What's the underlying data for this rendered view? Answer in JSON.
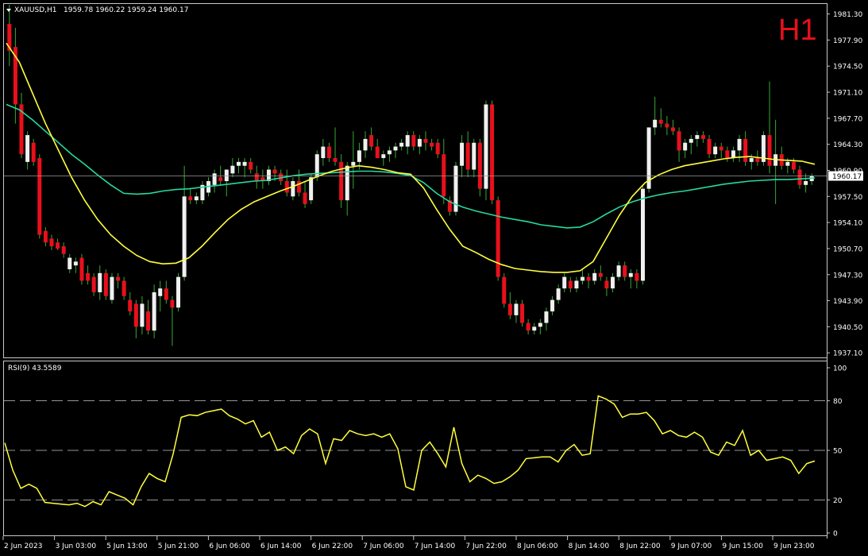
{
  "header": {
    "symbol": "XAUUSD,H1",
    "ohlc": "1959.78 1960.22 1959.24 1960.17",
    "timeframe": "H1"
  },
  "price_axis": {
    "ticks": [
      "1981.30",
      "1977.90",
      "1974.50",
      "1971.10",
      "1967.70",
      "1964.30",
      "1960.90",
      "1957.50",
      "1954.10",
      "1950.70",
      "1947.30",
      "1943.90",
      "1940.50",
      "1937.10"
    ],
    "current_price": "1960.17"
  },
  "rsi_panel": {
    "label": "RSI(9) 43.5589",
    "ticks": [
      "100",
      "80",
      "50",
      "20",
      "0"
    ],
    "levels": [
      80,
      50,
      20
    ]
  },
  "time_axis": {
    "labels": [
      "2 Jun 2023",
      "3 Jun 03:00",
      "5 Jun 13:00",
      "5 Jun 21:00",
      "6 Jun 06:00",
      "6 Jun 14:00",
      "6 Jun 22:00",
      "7 Jun 06:00",
      "7 Jun 14:00",
      "7 Jun 22:00",
      "8 Jun 06:00",
      "8 Jun 14:00",
      "8 Jun 22:00",
      "9 Jun 07:00",
      "9 Jun 15:00",
      "9 Jun 23:00"
    ]
  },
  "colors": {
    "background": "#000000",
    "bull": "#f0f0f0",
    "bear": "#e8101c",
    "wick": "#37a837",
    "ma_fast": "#ffff3c",
    "ma_slow": "#25d9a0",
    "rsi": "#ffff3c",
    "grid_text": "#ffffff",
    "timeframe": "#e8101c"
  },
  "chart_data": {
    "type": "candlestick",
    "title": "XAUUSD,H1",
    "ylim": [
      1936.5,
      1982.5
    ],
    "candles": [
      {
        "o": 1980.0,
        "h": 1982.5,
        "l": 1974.5,
        "c": 1976.5
      },
      {
        "o": 1977.0,
        "h": 1979.5,
        "l": 1967.0,
        "c": 1969.5
      },
      {
        "o": 1969.5,
        "h": 1971.0,
        "l": 1962.5,
        "c": 1963.0
      },
      {
        "o": 1962.0,
        "h": 1966.0,
        "l": 1961.0,
        "c": 1965.5
      },
      {
        "o": 1964.5,
        "h": 1965.0,
        "l": 1961.5,
        "c": 1962.0
      },
      {
        "o": 1962.5,
        "h": 1963.0,
        "l": 1952.0,
        "c": 1952.5
      },
      {
        "o": 1953.0,
        "h": 1953.5,
        "l": 1951.0,
        "c": 1951.5
      },
      {
        "o": 1952.0,
        "h": 1952.5,
        "l": 1950.5,
        "c": 1951.0
      },
      {
        "o": 1951.5,
        "h": 1952.0,
        "l": 1950.5,
        "c": 1950.7
      },
      {
        "o": 1951.0,
        "h": 1951.5,
        "l": 1949.5,
        "c": 1950.0
      },
      {
        "o": 1948.0,
        "h": 1950.0,
        "l": 1947.5,
        "c": 1949.5
      },
      {
        "o": 1948.5,
        "h": 1949.5,
        "l": 1947.5,
        "c": 1949.0
      },
      {
        "o": 1949.5,
        "h": 1950.0,
        "l": 1946.0,
        "c": 1946.5
      },
      {
        "o": 1947.5,
        "h": 1948.5,
        "l": 1946.0,
        "c": 1946.5
      },
      {
        "o": 1947.0,
        "h": 1947.5,
        "l": 1944.5,
        "c": 1945.0
      },
      {
        "o": 1945.0,
        "h": 1948.5,
        "l": 1944.0,
        "c": 1947.5
      },
      {
        "o": 1947.5,
        "h": 1948.0,
        "l": 1944.0,
        "c": 1944.5
      },
      {
        "o": 1944.0,
        "h": 1947.5,
        "l": 1943.5,
        "c": 1947.0
      },
      {
        "o": 1947.0,
        "h": 1947.5,
        "l": 1945.5,
        "c": 1946.5
      },
      {
        "o": 1946.5,
        "h": 1947.0,
        "l": 1944.0,
        "c": 1944.5
      },
      {
        "o": 1944.0,
        "h": 1945.0,
        "l": 1942.0,
        "c": 1942.5
      },
      {
        "o": 1943.5,
        "h": 1944.0,
        "l": 1939.0,
        "c": 1940.5
      },
      {
        "o": 1940.5,
        "h": 1944.5,
        "l": 1939.5,
        "c": 1943.5
      },
      {
        "o": 1942.5,
        "h": 1944.0,
        "l": 1939.5,
        "c": 1940.0
      },
      {
        "o": 1940.0,
        "h": 1946.0,
        "l": 1939.0,
        "c": 1945.0
      },
      {
        "o": 1944.5,
        "h": 1946.5,
        "l": 1942.5,
        "c": 1945.5
      },
      {
        "o": 1945.5,
        "h": 1946.5,
        "l": 1943.5,
        "c": 1944.0
      },
      {
        "o": 1944.0,
        "h": 1944.5,
        "l": 1938.0,
        "c": 1943.0
      },
      {
        "o": 1943.0,
        "h": 1947.5,
        "l": 1942.5,
        "c": 1947.0
      },
      {
        "o": 1947.0,
        "h": 1961.5,
        "l": 1946.5,
        "c": 1957.5
      },
      {
        "o": 1957.5,
        "h": 1958.5,
        "l": 1956.5,
        "c": 1957.0
      },
      {
        "o": 1957.0,
        "h": 1958.0,
        "l": 1956.5,
        "c": 1957.5
      },
      {
        "o": 1957.0,
        "h": 1959.5,
        "l": 1956.5,
        "c": 1959.0
      },
      {
        "o": 1958.0,
        "h": 1960.0,
        "l": 1957.5,
        "c": 1959.5
      },
      {
        "o": 1959.0,
        "h": 1961.0,
        "l": 1958.0,
        "c": 1960.5
      },
      {
        "o": 1960.0,
        "h": 1961.5,
        "l": 1959.0,
        "c": 1959.5
      },
      {
        "o": 1959.5,
        "h": 1961.0,
        "l": 1957.5,
        "c": 1961.0
      },
      {
        "o": 1960.5,
        "h": 1962.5,
        "l": 1960.0,
        "c": 1961.5
      },
      {
        "o": 1961.5,
        "h": 1962.5,
        "l": 1960.5,
        "c": 1962.0
      },
      {
        "o": 1961.5,
        "h": 1962.5,
        "l": 1960.0,
        "c": 1962.0
      },
      {
        "o": 1962.0,
        "h": 1962.5,
        "l": 1960.5,
        "c": 1961.0
      },
      {
        "o": 1960.5,
        "h": 1961.5,
        "l": 1958.5,
        "c": 1959.5
      },
      {
        "o": 1960.0,
        "h": 1961.0,
        "l": 1958.5,
        "c": 1959.5
      },
      {
        "o": 1959.5,
        "h": 1961.5,
        "l": 1959.0,
        "c": 1961.0
      },
      {
        "o": 1961.0,
        "h": 1961.5,
        "l": 1959.5,
        "c": 1960.5
      },
      {
        "o": 1960.5,
        "h": 1961.0,
        "l": 1959.0,
        "c": 1959.5
      },
      {
        "o": 1959.5,
        "h": 1961.0,
        "l": 1957.5,
        "c": 1958.0
      },
      {
        "o": 1957.5,
        "h": 1960.0,
        "l": 1957.0,
        "c": 1959.5
      },
      {
        "o": 1959.5,
        "h": 1961.0,
        "l": 1957.5,
        "c": 1958.0
      },
      {
        "o": 1958.0,
        "h": 1959.5,
        "l": 1956.0,
        "c": 1956.5
      },
      {
        "o": 1957.0,
        "h": 1960.5,
        "l": 1956.5,
        "c": 1960.0
      },
      {
        "o": 1960.0,
        "h": 1963.5,
        "l": 1959.5,
        "c": 1963.0
      },
      {
        "o": 1962.5,
        "h": 1965.0,
        "l": 1961.5,
        "c": 1964.0
      },
      {
        "o": 1964.0,
        "h": 1964.5,
        "l": 1962.0,
        "c": 1962.5
      },
      {
        "o": 1962.5,
        "h": 1966.5,
        "l": 1961.5,
        "c": 1962.0
      },
      {
        "o": 1962.0,
        "h": 1963.0,
        "l": 1956.0,
        "c": 1957.0
      },
      {
        "o": 1957.0,
        "h": 1962.0,
        "l": 1955.0,
        "c": 1961.5
      },
      {
        "o": 1961.5,
        "h": 1966.0,
        "l": 1958.5,
        "c": 1962.0
      },
      {
        "o": 1962.0,
        "h": 1964.5,
        "l": 1961.0,
        "c": 1963.5
      },
      {
        "o": 1963.5,
        "h": 1966.0,
        "l": 1962.5,
        "c": 1965.0
      },
      {
        "o": 1965.5,
        "h": 1966.5,
        "l": 1963.5,
        "c": 1964.0
      },
      {
        "o": 1964.0,
        "h": 1965.0,
        "l": 1962.5,
        "c": 1962.5
      },
      {
        "o": 1962.5,
        "h": 1963.5,
        "l": 1961.5,
        "c": 1963.0
      },
      {
        "o": 1963.0,
        "h": 1964.0,
        "l": 1962.0,
        "c": 1963.5
      },
      {
        "o": 1963.5,
        "h": 1964.5,
        "l": 1962.5,
        "c": 1964.0
      },
      {
        "o": 1964.0,
        "h": 1965.0,
        "l": 1963.5,
        "c": 1964.5
      },
      {
        "o": 1964.0,
        "h": 1966.0,
        "l": 1963.0,
        "c": 1965.5
      },
      {
        "o": 1965.5,
        "h": 1966.0,
        "l": 1963.5,
        "c": 1964.0
      },
      {
        "o": 1964.0,
        "h": 1965.5,
        "l": 1963.0,
        "c": 1965.0
      },
      {
        "o": 1965.0,
        "h": 1966.0,
        "l": 1963.5,
        "c": 1964.5
      },
      {
        "o": 1964.5,
        "h": 1965.0,
        "l": 1963.5,
        "c": 1964.0
      },
      {
        "o": 1964.5,
        "h": 1965.0,
        "l": 1962.5,
        "c": 1963.0
      },
      {
        "o": 1963.0,
        "h": 1965.0,
        "l": 1956.5,
        "c": 1957.5
      },
      {
        "o": 1957.0,
        "h": 1957.5,
        "l": 1955.0,
        "c": 1955.5
      },
      {
        "o": 1955.5,
        "h": 1962.0,
        "l": 1955.0,
        "c": 1961.5
      },
      {
        "o": 1961.5,
        "h": 1965.5,
        "l": 1960.0,
        "c": 1964.5
      },
      {
        "o": 1964.5,
        "h": 1966.0,
        "l": 1960.0,
        "c": 1961.0
      },
      {
        "o": 1961.0,
        "h": 1965.0,
        "l": 1960.0,
        "c": 1964.5
      },
      {
        "o": 1964.5,
        "h": 1965.0,
        "l": 1957.5,
        "c": 1958.5
      },
      {
        "o": 1958.5,
        "h": 1970.0,
        "l": 1957.0,
        "c": 1969.5
      },
      {
        "o": 1969.5,
        "h": 1970.0,
        "l": 1956.5,
        "c": 1957.0
      },
      {
        "o": 1957.0,
        "h": 1957.5,
        "l": 1946.5,
        "c": 1947.0
      },
      {
        "o": 1947.0,
        "h": 1947.5,
        "l": 1943.0,
        "c": 1943.5
      },
      {
        "o": 1943.5,
        "h": 1945.0,
        "l": 1941.5,
        "c": 1942.0
      },
      {
        "o": 1942.0,
        "h": 1944.0,
        "l": 1941.0,
        "c": 1943.5
      },
      {
        "o": 1943.5,
        "h": 1944.0,
        "l": 1940.5,
        "c": 1941.0
      },
      {
        "o": 1941.0,
        "h": 1941.5,
        "l": 1939.5,
        "c": 1940.0
      },
      {
        "o": 1940.0,
        "h": 1941.0,
        "l": 1939.5,
        "c": 1940.5
      },
      {
        "o": 1940.5,
        "h": 1941.5,
        "l": 1939.5,
        "c": 1941.0
      },
      {
        "o": 1941.0,
        "h": 1943.0,
        "l": 1940.0,
        "c": 1942.5
      },
      {
        "o": 1942.5,
        "h": 1944.5,
        "l": 1942.0,
        "c": 1944.0
      },
      {
        "o": 1944.0,
        "h": 1946.0,
        "l": 1943.5,
        "c": 1945.5
      },
      {
        "o": 1945.5,
        "h": 1947.5,
        "l": 1945.0,
        "c": 1947.0
      },
      {
        "o": 1946.5,
        "h": 1947.0,
        "l": 1945.0,
        "c": 1945.5
      },
      {
        "o": 1945.5,
        "h": 1947.0,
        "l": 1945.0,
        "c": 1946.5
      },
      {
        "o": 1946.5,
        "h": 1948.0,
        "l": 1946.0,
        "c": 1947.0
      },
      {
        "o": 1947.0,
        "h": 1947.5,
        "l": 1945.5,
        "c": 1946.5
      },
      {
        "o": 1946.5,
        "h": 1948.0,
        "l": 1946.0,
        "c": 1947.5
      },
      {
        "o": 1947.5,
        "h": 1948.5,
        "l": 1946.5,
        "c": 1947.0
      },
      {
        "o": 1946.5,
        "h": 1947.0,
        "l": 1944.5,
        "c": 1945.5
      },
      {
        "o": 1945.5,
        "h": 1947.5,
        "l": 1945.0,
        "c": 1947.0
      },
      {
        "o": 1947.0,
        "h": 1949.0,
        "l": 1946.5,
        "c": 1948.5
      },
      {
        "o": 1948.5,
        "h": 1949.0,
        "l": 1946.5,
        "c": 1947.0
      },
      {
        "o": 1947.0,
        "h": 1948.0,
        "l": 1945.5,
        "c": 1947.5
      },
      {
        "o": 1947.5,
        "h": 1948.0,
        "l": 1945.5,
        "c": 1946.5
      },
      {
        "o": 1946.5,
        "h": 1959.0,
        "l": 1946.0,
        "c": 1958.5
      },
      {
        "o": 1958.5,
        "h": 1965.5,
        "l": 1958.0,
        "c": 1966.5
      },
      {
        "o": 1966.5,
        "h": 1970.5,
        "l": 1965.5,
        "c": 1967.5
      },
      {
        "o": 1967.5,
        "h": 1969.0,
        "l": 1966.5,
        "c": 1967.0
      },
      {
        "o": 1967.0,
        "h": 1968.0,
        "l": 1965.5,
        "c": 1966.5
      },
      {
        "o": 1966.5,
        "h": 1967.5,
        "l": 1965.5,
        "c": 1966.0
      },
      {
        "o": 1966.0,
        "h": 1966.5,
        "l": 1962.0,
        "c": 1963.5
      },
      {
        "o": 1963.5,
        "h": 1965.0,
        "l": 1962.5,
        "c": 1964.5
      },
      {
        "o": 1964.5,
        "h": 1965.5,
        "l": 1963.0,
        "c": 1965.0
      },
      {
        "o": 1965.0,
        "h": 1966.0,
        "l": 1964.0,
        "c": 1965.5
      },
      {
        "o": 1965.5,
        "h": 1966.0,
        "l": 1964.5,
        "c": 1965.0
      },
      {
        "o": 1965.0,
        "h": 1965.5,
        "l": 1962.5,
        "c": 1963.0
      },
      {
        "o": 1963.0,
        "h": 1964.5,
        "l": 1962.5,
        "c": 1964.0
      },
      {
        "o": 1964.0,
        "h": 1964.5,
        "l": 1962.5,
        "c": 1963.5
      },
      {
        "o": 1963.5,
        "h": 1964.0,
        "l": 1962.0,
        "c": 1962.5
      },
      {
        "o": 1962.5,
        "h": 1964.0,
        "l": 1962.0,
        "c": 1963.5
      },
      {
        "o": 1963.5,
        "h": 1965.5,
        "l": 1962.0,
        "c": 1965.0
      },
      {
        "o": 1965.0,
        "h": 1966.0,
        "l": 1961.5,
        "c": 1962.0
      },
      {
        "o": 1962.0,
        "h": 1963.0,
        "l": 1961.0,
        "c": 1962.5
      },
      {
        "o": 1962.5,
        "h": 1963.5,
        "l": 1961.5,
        "c": 1962.0
      },
      {
        "o": 1962.0,
        "h": 1966.0,
        "l": 1961.5,
        "c": 1965.5
      },
      {
        "o": 1965.5,
        "h": 1972.5,
        "l": 1960.5,
        "c": 1961.5
      },
      {
        "o": 1961.5,
        "h": 1967.5,
        "l": 1956.5,
        "c": 1963.0
      },
      {
        "o": 1963.0,
        "h": 1964.0,
        "l": 1961.0,
        "c": 1961.5
      },
      {
        "o": 1961.5,
        "h": 1962.5,
        "l": 1960.5,
        "c": 1962.0
      },
      {
        "o": 1962.0,
        "h": 1962.5,
        "l": 1960.5,
        "c": 1961.0
      },
      {
        "o": 1961.0,
        "h": 1961.5,
        "l": 1958.5,
        "c": 1959.0
      },
      {
        "o": 1959.0,
        "h": 1960.5,
        "l": 1958.0,
        "c": 1959.5
      },
      {
        "o": 1959.5,
        "h": 1960.5,
        "l": 1959.0,
        "c": 1960.17
      }
    ],
    "ma_fast": [
      1977.5,
      1975,
      1971,
      1967,
      1963.5,
      1960,
      1957,
      1954.5,
      1952.5,
      1951,
      1949.8,
      1949,
      1948.7,
      1948.8,
      1949.5,
      1951,
      1952.8,
      1954.5,
      1955.8,
      1956.8,
      1957.5,
      1958.2,
      1958.8,
      1959.5,
      1960.2,
      1960.8,
      1961.2,
      1961.5,
      1961.3,
      1961,
      1960.6,
      1960.4,
      1958.6,
      1955.8,
      1953.2,
      1951,
      1950.2,
      1949.3,
      1948.6,
      1948.1,
      1947.9,
      1947.7,
      1947.6,
      1947.6,
      1947.8,
      1949,
      1952,
      1955,
      1957.5,
      1959.3,
      1960.3,
      1961,
      1961.5,
      1961.8,
      1962.1,
      1962.4,
      1962.6,
      1962.7,
      1962.5,
      1962.3,
      1962.2,
      1962.1,
      1961.7
    ],
    "ma_slow": [
      1969.5,
      1968.8,
      1967.5,
      1966,
      1964.5,
      1963,
      1961.7,
      1960.3,
      1959,
      1957.9,
      1957.8,
      1957.9,
      1958.2,
      1958.4,
      1958.5,
      1958.7,
      1958.9,
      1959.1,
      1959.3,
      1959.5,
      1959.6,
      1959.9,
      1960.2,
      1960.4,
      1960.5,
      1960.6,
      1960.7,
      1960.8,
      1960.8,
      1960.7,
      1960.5,
      1960.2,
      1959.3,
      1957.9,
      1956.8,
      1956.1,
      1955.6,
      1955.2,
      1954.8,
      1954.5,
      1954.2,
      1953.8,
      1953.6,
      1953.4,
      1953.5,
      1954.2,
      1955.2,
      1956.1,
      1956.8,
      1957.3,
      1957.7,
      1958.0,
      1958.2,
      1958.5,
      1958.8,
      1959.1,
      1959.3,
      1959.5,
      1959.6,
      1959.7,
      1959.7,
      1959.8,
      1959.9
    ],
    "rsi": [
      54.5,
      38,
      27,
      29.5,
      27,
      18.5,
      18,
      17.5,
      17,
      18,
      16,
      19,
      17,
      25,
      23,
      21,
      17,
      28,
      36,
      33,
      31,
      48,
      70,
      71.5,
      71,
      73,
      74,
      75,
      71,
      69,
      66,
      68,
      58,
      61,
      50,
      52,
      48,
      59,
      63,
      60,
      42,
      57,
      56,
      62,
      60,
      59,
      60,
      58,
      60,
      51,
      28,
      26,
      50,
      55,
      48,
      40,
      64,
      42,
      31,
      35,
      33,
      30,
      31,
      34,
      38,
      45,
      45.5,
      46,
      46,
      43,
      50,
      53.5,
      47,
      48,
      83,
      81,
      78,
      70,
      72,
      72,
      73,
      68,
      60,
      62,
      59,
      58,
      61,
      58,
      49,
      47,
      55,
      53,
      62,
      47,
      50,
      44,
      45,
      46,
      44,
      36,
      42,
      43.56
    ],
    "rsi_ylim": [
      0,
      100
    ]
  }
}
